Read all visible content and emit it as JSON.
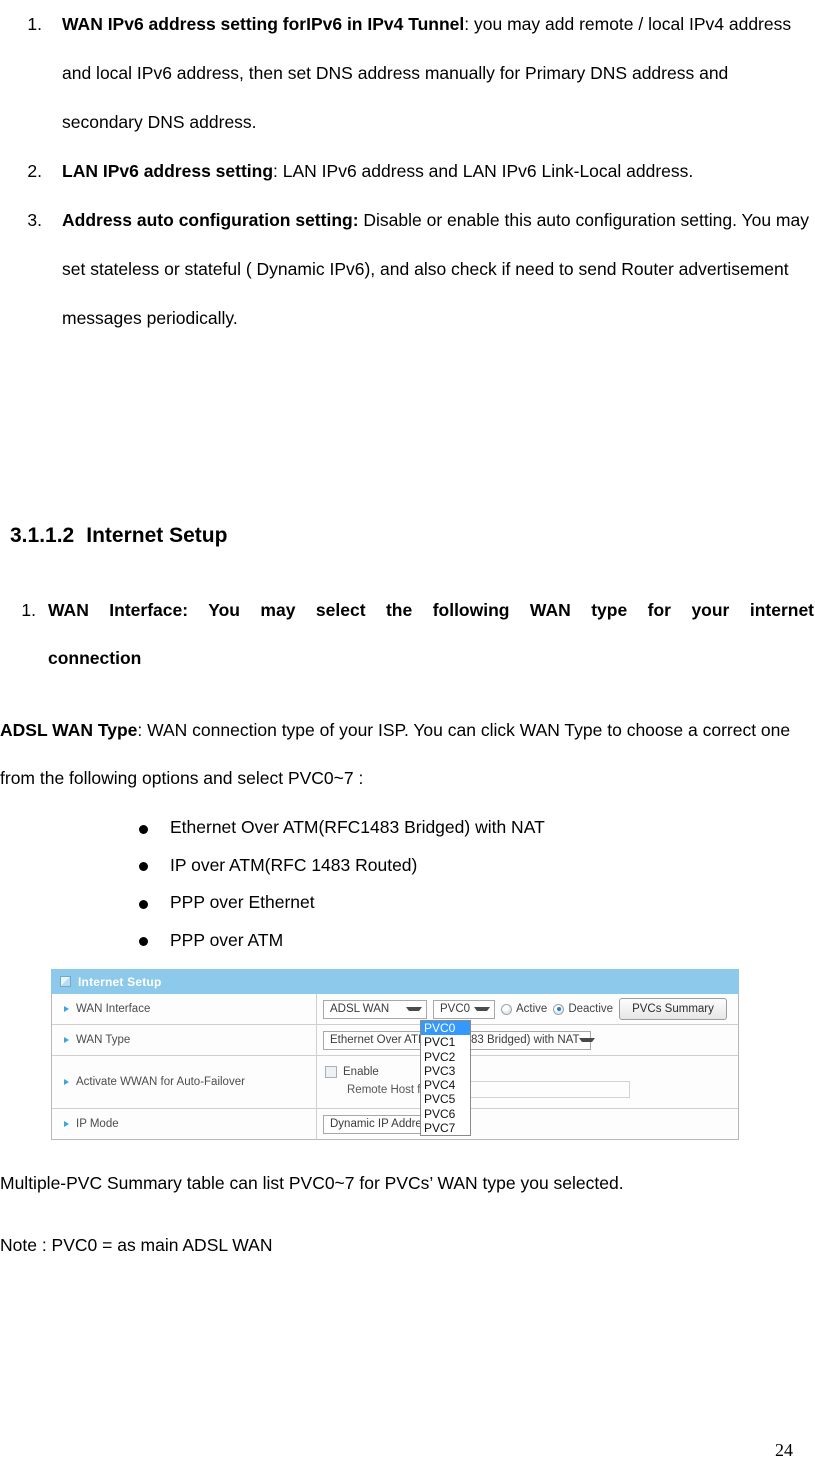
{
  "document": {
    "page_number": "24",
    "intro_list": [
      {
        "number": "1.",
        "bold": "WAN IPv6 address setting forIPv6 in IPv4 Tunnel",
        "rest": ": you may add remote / local IPv4 address and local IPv6 address, then set DNS address manually for Primary DNS address and secondary DNS address."
      },
      {
        "number": "2.",
        "bold": "LAN IPv6 address setting",
        "rest": ": LAN IPv6 address and LAN IPv6 Link-Local address."
      },
      {
        "number": "3.",
        "bold": "Address auto configuration setting:",
        "rest": " Disable or enable this auto configuration setting. You may set stateless or stateful ( Dynamic IPv6), and also check if need to send Router advertisement messages periodically."
      }
    ],
    "section": {
      "number": "3.1.1.2",
      "title": "Internet Setup"
    },
    "wan_interface_item": {
      "number": "1.",
      "line1": "WAN Interface: You may select the following WAN type for your internet",
      "line2": "connection"
    },
    "adsl_paragraph": {
      "bold": "ADSL WAN Type",
      "rest": ": WAN connection type of your ISP. You can click WAN Type to choose a correct one from the following options and select PVC0~7 :"
    },
    "wan_type_bullets": [
      "Ethernet Over ATM(RFC1483 Bridged) with NAT",
      "IP over ATM(RFC 1483 Routed)",
      "PPP over Ethernet",
      "PPP over ATM"
    ],
    "tail_paragraphs": [
      "Multiple-PVC Summary table can list PVC0~7 for PVCs’ WAN type you selected.",
      "Note : PVC0 = as main ADSL WAN"
    ]
  },
  "router_ui": {
    "panel_title": "Internet Setup",
    "header_color": "#8dc9ea",
    "rows": {
      "wan_interface": {
        "label": "WAN Interface",
        "interface_select": "ADSL WAN",
        "pvc_select": "PVC0",
        "radio_active": "Active",
        "radio_deactive": "Deactive",
        "selected_radio": "Deactive",
        "summary_button": "PVCs Summary"
      },
      "wan_type": {
        "label": "WAN Type",
        "value_left": "Ethernet Over ATM (",
        "value_right": "Bridged) with NAT",
        "full_value": "Ethernet Over ATM (RFC1483 Bridged) with NAT"
      },
      "wwan": {
        "label": "Activate WWAN for Auto-Failover",
        "enable_label": "Enable",
        "enable_checked": false,
        "remote_host_label": "Remote Host for k",
        "remote_host_value": ""
      },
      "ip_mode": {
        "label": "IP Mode",
        "value": "Dynamic IP Address"
      }
    },
    "open_dropdown": {
      "selected": "PVC0",
      "highlight_color": "#3399ff",
      "options": [
        "PVC0",
        "PVC1",
        "PVC2",
        "PVC3",
        "PVC4",
        "PVC5",
        "PVC6",
        "PVC7"
      ]
    }
  }
}
